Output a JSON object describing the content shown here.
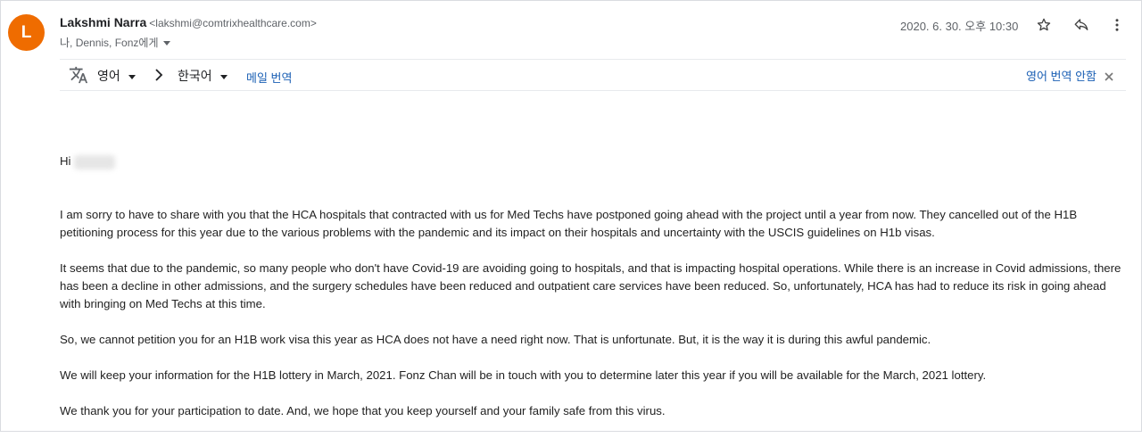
{
  "sender": {
    "avatar_letter": "L",
    "avatar_color": "#ef6c00",
    "name": "Lakshmi Narra",
    "email": "<lakshmi@comtrixhealthcare.com>",
    "recipients": "나, Dennis, Fonz에게"
  },
  "header": {
    "date": "2020. 6. 30. 오후 10:30",
    "icons": [
      "star-icon",
      "reply-icon",
      "more-vert-icon"
    ]
  },
  "translate": {
    "source_lang": "영어",
    "target_lang": "한국어",
    "translate_message": "메일 번역",
    "dont_translate": "영어 번역 안함"
  },
  "body": {
    "greeting": "Hi",
    "paragraphs": [
      "I am sorry to have to share with you that the HCA hospitals that contracted with us for Med Techs have postponed going ahead with the project until a year from now.  They cancelled out of the H1B petitioning process for this year due to the various problems with the pandemic and its impact on their hospitals and uncertainty with the USCIS guidelines on H1b visas.",
      "It seems that due to the pandemic, so many people who don't have Covid-19 are avoiding going to hospitals, and that is impacting hospital operations.  While there is an increase in Covid admissions, there has been a decline in other admissions, and the surgery schedules have been reduced and outpatient care services have been reduced.  So, unfortunately, HCA has had to reduce its risk in going ahead with bringing on Med Techs at this time.",
      "So, we cannot petition you for an H1B work visa this year as HCA does not have a need right now.  That is unfortunate.  But, it is the way it is during this awful pandemic.",
      "We will keep your information for the H1B lottery in March, 2021.  Fonz Chan will be in touch with you to determine later this year if you will be available for the March, 2021 lottery.",
      "We thank you for your participation to date. And, we hope that you keep yourself and your family safe from this virus."
    ]
  }
}
